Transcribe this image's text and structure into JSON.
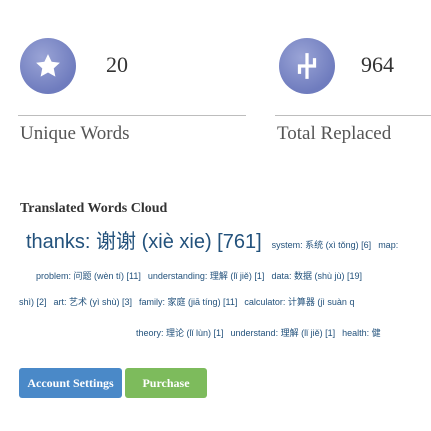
{
  "stats": [
    {
      "icon": "star-icon",
      "count": "20",
      "label": "Unique Words"
    },
    {
      "icon": "logo-icon",
      "count": "964",
      "label": "Total Replaced"
    }
  ],
  "cloud": {
    "title": "Translated Words Cloud",
    "lines": [
      [
        "thanks: 谢谢 (xiè xie) [761]",
        "system: 系统 (xì tǒng) [6]",
        "map:"
      ],
      [
        "problem: 问题 (wèn tí) [11]",
        "understanding: 理解 (lǐ jiě) [1]",
        "data: 数据 (shù jù) [19]"
      ],
      [
        "shì) [2]",
        "art: 艺术 (yì shù) [3]",
        "family: 家庭 (jiā tíng) [11]",
        "calculator: 计算器 (jì suàn q"
      ],
      [
        "theory: 理论 (lǐ lùn) [1]",
        "understand: 理解 (lǐ jiě) [1]",
        "health: 健"
      ]
    ]
  },
  "buttons": {
    "account": "Account Settings",
    "purchase": "Purchase"
  },
  "colors": {
    "badge": "#7a86c4",
    "link": "#23527c",
    "account_button": "#4a89c8",
    "purchase_button": "#7dbb5c"
  }
}
